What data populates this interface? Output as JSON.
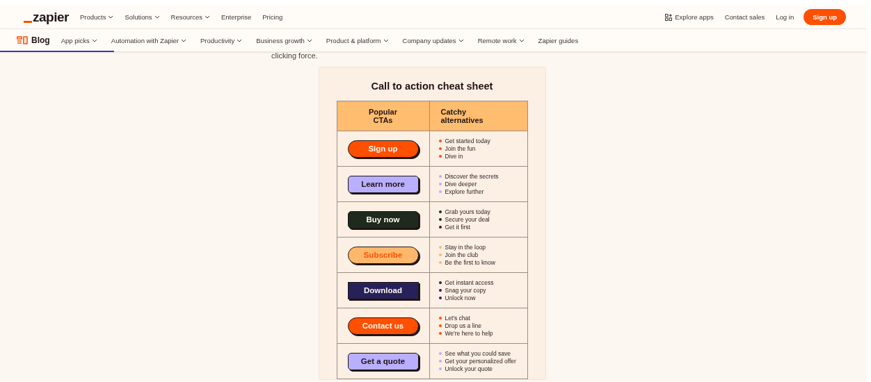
{
  "header": {
    "logo": "zapier",
    "nav": [
      {
        "label": "Products",
        "dropdown": true
      },
      {
        "label": "Solutions",
        "dropdown": true
      },
      {
        "label": "Resources",
        "dropdown": true
      },
      {
        "label": "Enterprise",
        "dropdown": false
      },
      {
        "label": "Pricing",
        "dropdown": false
      }
    ],
    "explore": "Explore apps",
    "contact": "Contact sales",
    "login": "Log in",
    "signup": "Sign up"
  },
  "subnav": {
    "title": "Blog",
    "items": [
      {
        "label": "App picks",
        "dropdown": true
      },
      {
        "label": "Automation with Zapier",
        "dropdown": true
      },
      {
        "label": "Productivity",
        "dropdown": true
      },
      {
        "label": "Business growth",
        "dropdown": true
      },
      {
        "label": "Product & platform",
        "dropdown": true
      },
      {
        "label": "Company updates",
        "dropdown": true
      },
      {
        "label": "Remote work",
        "dropdown": true
      },
      {
        "label": "Zapier guides",
        "dropdown": false
      }
    ]
  },
  "article_text": "clicking force.",
  "cheat_sheet": {
    "title": "Call to action cheat sheet",
    "columns": [
      "Popular CTAs",
      "Catchy alternatives"
    ],
    "rows": [
      {
        "cta": "Sign up",
        "kind": "pill",
        "color": "#ff4f00",
        "alternatives": [
          "Get started today",
          "Join the fun",
          "Dive in"
        ]
      },
      {
        "cta": "Learn more",
        "kind": "rounded",
        "color": "#b9afff",
        "alternatives": [
          "Discover the secrets",
          "Dive deeper",
          "Explore further"
        ]
      },
      {
        "cta": "Buy now",
        "kind": "rounded",
        "color": "#1f2a1f",
        "alternatives": [
          "Grab yours today",
          "Secure your deal",
          "Get it first"
        ]
      },
      {
        "cta": "Subscribe",
        "kind": "accentpill",
        "color": "#ffb86b",
        "alternatives": [
          "Stay in the loop",
          "Join the club",
          "Be the first to know"
        ]
      },
      {
        "cta": "Download",
        "kind": "square",
        "color": "#27215a",
        "alternatives": [
          "Get instant access",
          "Snag your copy",
          "Unlock now"
        ]
      },
      {
        "cta": "Contact us",
        "kind": "pill",
        "color": "#ff4f00",
        "alternatives": [
          "Let's chat",
          "Drop us a line",
          "We're here to help"
        ]
      },
      {
        "cta": "Get a quote",
        "kind": "rounded",
        "color": "#b9afff",
        "alternatives": [
          "See what you could save",
          "Get your personalized offer",
          "Unlock your quote"
        ]
      }
    ]
  }
}
